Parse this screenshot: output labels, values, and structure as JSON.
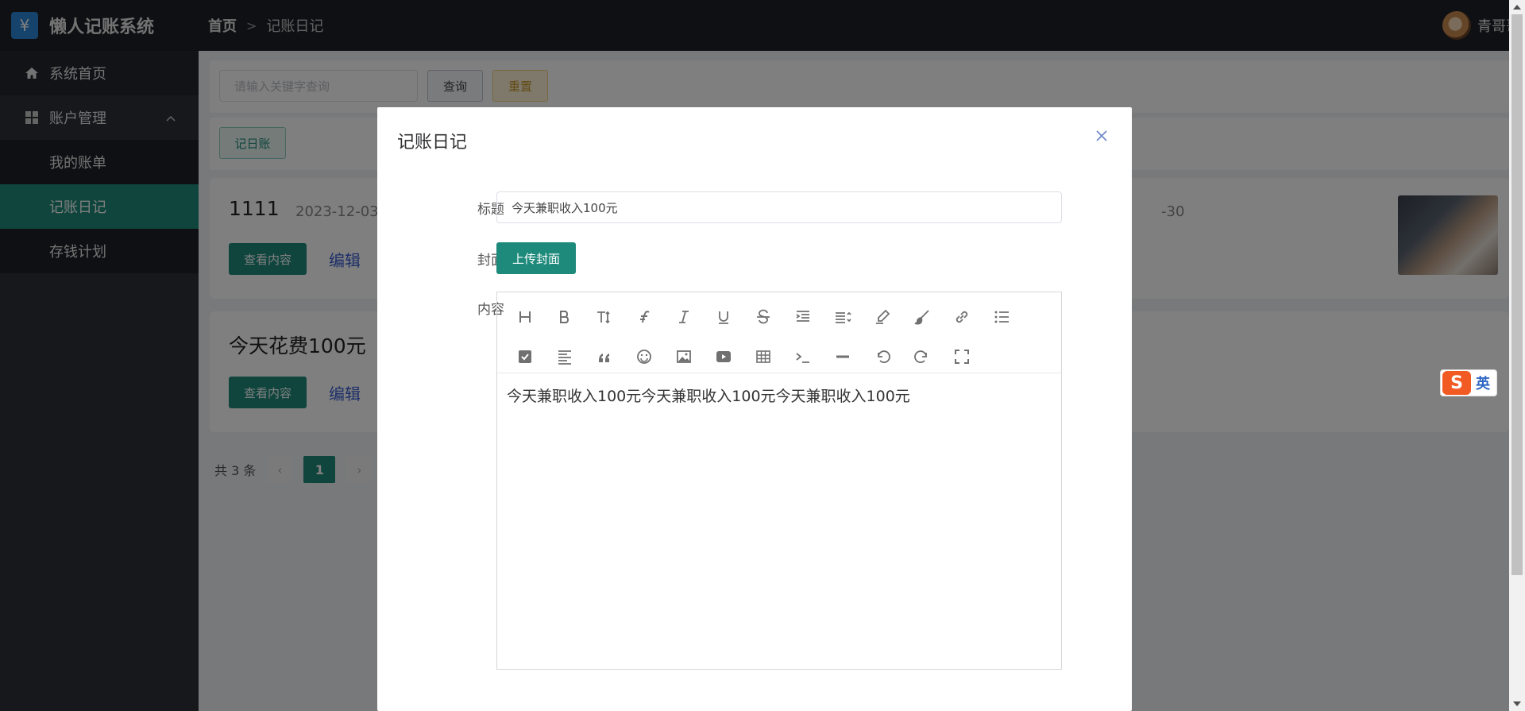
{
  "app": {
    "title": "懒人记账系统",
    "logo_glyph": "¥"
  },
  "breadcrumb": {
    "home": "首页",
    "separator": ">",
    "current": "记账日记"
  },
  "user": {
    "name": "青哥哥"
  },
  "sidebar": {
    "home": "系统首页",
    "group": "账户管理",
    "items": [
      {
        "label": "我的账单"
      },
      {
        "label": "记账日记"
      },
      {
        "label": "存钱计划"
      }
    ]
  },
  "search": {
    "placeholder": "请输入关键字查询",
    "query_label": "查询",
    "reset_label": "重置"
  },
  "toolbar": {
    "add_label": "记日账"
  },
  "cards": [
    {
      "title": "1111",
      "date": "2023-12-03",
      "date_right": "-30",
      "view_label": "查看内容",
      "edit_label": "编辑"
    },
    {
      "title": "今天花费100元",
      "view_label": "查看内容",
      "edit_label": "编辑"
    }
  ],
  "pager": {
    "total": "共 3 条",
    "current_page": "1",
    "prev": "‹",
    "next": "›"
  },
  "dialog": {
    "title": "记账日记",
    "title_label": "标题",
    "title_value": "今天兼职收入100元",
    "cover_label": "封面",
    "upload_label": "上传封面",
    "content_label": "内容",
    "content_text": "今天兼职收入100元今天兼职收入100元今天兼职收入100元"
  },
  "ime": {
    "mark": "S",
    "lang": "英"
  },
  "colors": {
    "accent": "#1e8a7b",
    "header": "#1f2127",
    "sidebar": "#2d3039"
  }
}
